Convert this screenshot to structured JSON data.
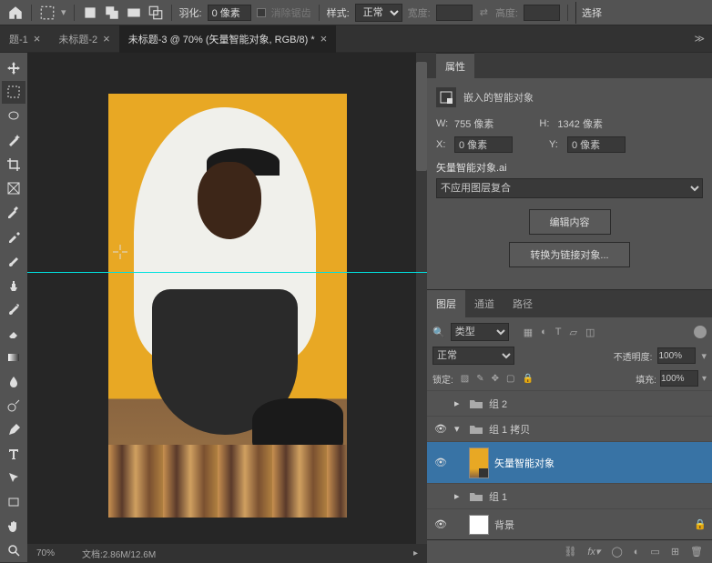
{
  "top_toolbar": {
    "feather_label": "羽化:",
    "feather_value": "0 像素",
    "anti_alias": "消除锯齿",
    "style_label": "样式:",
    "style_value": "正常",
    "width_label": "宽度:",
    "height_label": "高度:",
    "select_all": "选择"
  },
  "tabs": [
    {
      "label": "题-1"
    },
    {
      "label": "未标题-2"
    },
    {
      "label": "未标题-3 @ 70% (矢量智能对象, RGB/8) *",
      "active": true
    }
  ],
  "status": {
    "zoom": "70%",
    "doc_info": "文档:2.86M/12.6M"
  },
  "properties": {
    "header": "属性",
    "object_type": "嵌入的智能对象",
    "w_label": "W:",
    "w_value": "755 像素",
    "h_label": "H:",
    "h_value": "1342 像素",
    "x_label": "X:",
    "x_value": "0 像素",
    "y_label": "Y:",
    "y_value": "0 像素",
    "file_name": "矢量智能对象.ai",
    "layer_comp_value": "不应用图层复合",
    "edit_btn": "编辑内容",
    "convert_btn": "转换为链接对象..."
  },
  "layers_panel": {
    "tabs": {
      "layers": "图层",
      "channels": "通道",
      "paths": "路径"
    },
    "kind_label": "类型",
    "blend_mode": "正常",
    "opacity_label": "不透明度:",
    "opacity_value": "100%",
    "lock_label": "锁定:",
    "fill_label": "填充:",
    "fill_value": "100%",
    "layers": [
      {
        "name": "组 2",
        "type": "group",
        "visible": false,
        "open": false
      },
      {
        "name": "组 1 拷贝",
        "type": "group",
        "visible": true,
        "open": true
      },
      {
        "name": "矢量智能对象",
        "type": "smart",
        "visible": true,
        "selected": true
      },
      {
        "name": "组 1",
        "type": "group",
        "visible": false,
        "open": false
      },
      {
        "name": "背景",
        "type": "bg",
        "visible": true,
        "locked": true
      }
    ]
  }
}
